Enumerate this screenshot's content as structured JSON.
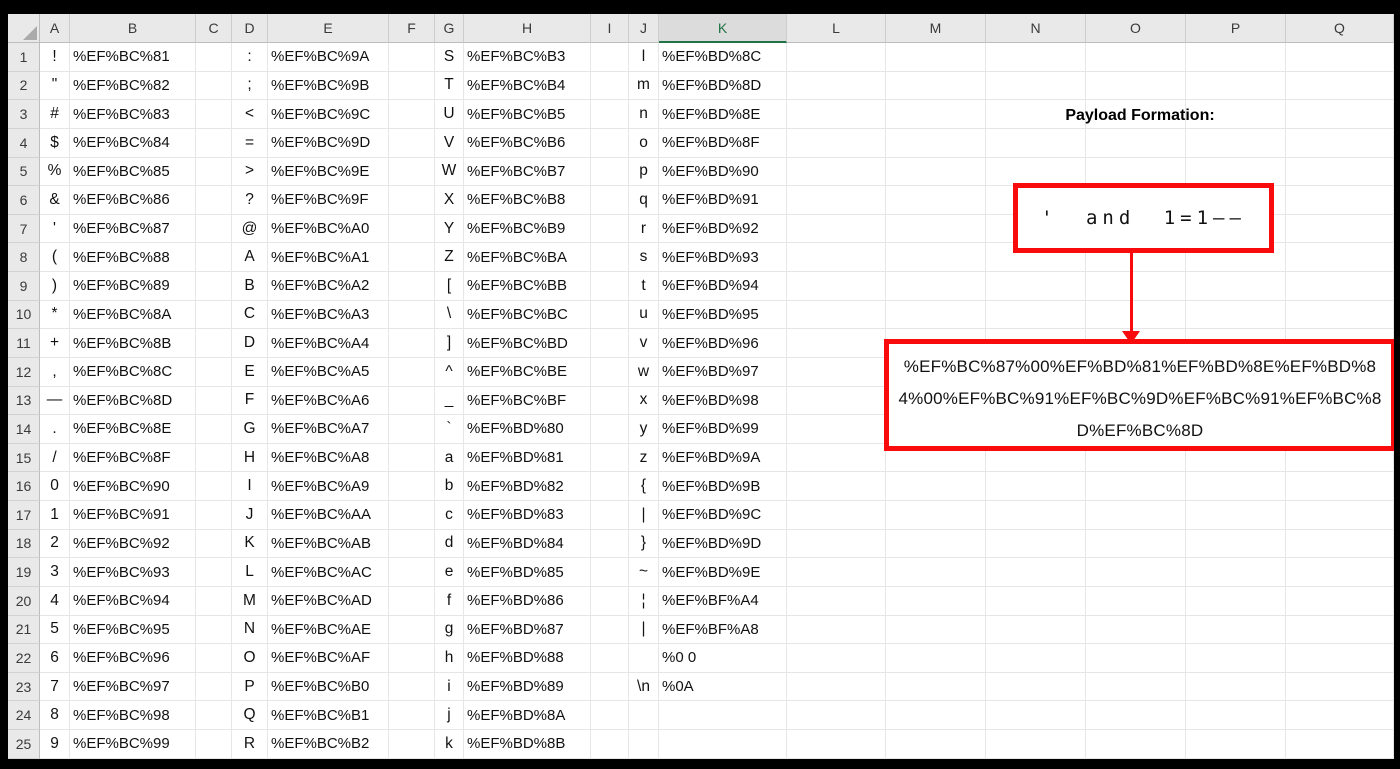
{
  "colors": {
    "accent_green": "#217346",
    "annotation_red": "#F90A0D",
    "header_bg": "#E9E9E9",
    "header_selected_bg": "#DCDCDC",
    "grid_line": "#E6E6E6",
    "cell_text": "#111111"
  },
  "grid": {
    "column_headers": [
      "A",
      "B",
      "C",
      "D",
      "E",
      "F",
      "G",
      "H",
      "I",
      "J",
      "K",
      "L",
      "M",
      "N",
      "O",
      "P",
      "Q"
    ],
    "selected_column": "K",
    "rows": [
      {
        "n": 1,
        "A": "!",
        "B": "%EF%BC%81",
        "D": ":",
        "E": "%EF%BC%9A",
        "G": "S",
        "H": "%EF%BC%B3",
        "J": "l",
        "K": "%EF%BD%8C"
      },
      {
        "n": 2,
        "A": "\"",
        "B": "%EF%BC%82",
        "D": ";",
        "E": "%EF%BC%9B",
        "G": "T",
        "H": "%EF%BC%B4",
        "J": "m",
        "K": "%EF%BD%8D"
      },
      {
        "n": 3,
        "A": "#",
        "B": "%EF%BC%83",
        "D": "<",
        "E": "%EF%BC%9C",
        "G": "U",
        "H": "%EF%BC%B5",
        "J": "n",
        "K": "%EF%BD%8E"
      },
      {
        "n": 4,
        "A": "$",
        "B": "%EF%BC%84",
        "D": "=",
        "E": "%EF%BC%9D",
        "G": "V",
        "H": "%EF%BC%B6",
        "J": "o",
        "K": "%EF%BD%8F"
      },
      {
        "n": 5,
        "A": "%",
        "B": "%EF%BC%85",
        "D": ">",
        "E": "%EF%BC%9E",
        "G": "W",
        "H": "%EF%BC%B7",
        "J": "p",
        "K": "%EF%BD%90"
      },
      {
        "n": 6,
        "A": "&",
        "B": "%EF%BC%86",
        "D": "?",
        "E": "%EF%BC%9F",
        "G": "X",
        "H": "%EF%BC%B8",
        "J": "q",
        "K": "%EF%BD%91"
      },
      {
        "n": 7,
        "A": "'",
        "B": "%EF%BC%87",
        "D": "@",
        "E": "%EF%BC%A0",
        "G": "Y",
        "H": "%EF%BC%B9",
        "J": "r",
        "K": "%EF%BD%92"
      },
      {
        "n": 8,
        "A": "(",
        "B": "%EF%BC%88",
        "D": "A",
        "E": "%EF%BC%A1",
        "G": "Z",
        "H": "%EF%BC%BA",
        "J": "s",
        "K": "%EF%BD%93"
      },
      {
        "n": 9,
        "A": ")",
        "B": "%EF%BC%89",
        "D": "B",
        "E": "%EF%BC%A2",
        "G": "[",
        "H": "%EF%BC%BB",
        "J": "t",
        "K": "%EF%BD%94"
      },
      {
        "n": 10,
        "A": "*",
        "B": "%EF%BC%8A",
        "D": "C",
        "E": "%EF%BC%A3",
        "G": "\\",
        "H": "%EF%BC%BC",
        "J": "u",
        "K": "%EF%BD%95"
      },
      {
        "n": 11,
        "A": "+",
        "B": "%EF%BC%8B",
        "D": "D",
        "E": "%EF%BC%A4",
        "G": "]",
        "H": "%EF%BC%BD",
        "J": "v",
        "K": "%EF%BD%96"
      },
      {
        "n": 12,
        "A": ",",
        "B": "%EF%BC%8C",
        "D": "E",
        "E": "%EF%BC%A5",
        "G": "^",
        "H": "%EF%BC%BE",
        "J": "w",
        "K": "%EF%BD%97"
      },
      {
        "n": 13,
        "A": "—",
        "B": "%EF%BC%8D",
        "D": "F",
        "E": "%EF%BC%A6",
        "G": "_",
        "H": "%EF%BC%BF",
        "J": "x",
        "K": "%EF%BD%98"
      },
      {
        "n": 14,
        "A": ".",
        "B": "%EF%BC%8E",
        "D": "G",
        "E": "%EF%BC%A7",
        "G": "`",
        "H": "%EF%BD%80",
        "J": "y",
        "K": "%EF%BD%99"
      },
      {
        "n": 15,
        "A": "/",
        "B": "%EF%BC%8F",
        "D": "H",
        "E": "%EF%BC%A8",
        "G": "a",
        "H": "%EF%BD%81",
        "J": "z",
        "K": "%EF%BD%9A"
      },
      {
        "n": 16,
        "A": "0",
        "B": "%EF%BC%90",
        "D": "I",
        "E": "%EF%BC%A9",
        "G": "b",
        "H": "%EF%BD%82",
        "J": "{",
        "K": "%EF%BD%9B"
      },
      {
        "n": 17,
        "A": "1",
        "B": "%EF%BC%91",
        "D": "J",
        "E": "%EF%BC%AA",
        "G": "c",
        "H": "%EF%BD%83",
        "J": "|",
        "K": "%EF%BD%9C"
      },
      {
        "n": 18,
        "A": "2",
        "B": "%EF%BC%92",
        "D": "K",
        "E": "%EF%BC%AB",
        "G": "d",
        "H": "%EF%BD%84",
        "J": "}",
        "K": "%EF%BD%9D"
      },
      {
        "n": 19,
        "A": "3",
        "B": "%EF%BC%93",
        "D": "L",
        "E": "%EF%BC%AC",
        "G": "e",
        "H": "%EF%BD%85",
        "J": "~",
        "K": "%EF%BD%9E"
      },
      {
        "n": 20,
        "A": "4",
        "B": "%EF%BC%94",
        "D": "M",
        "E": "%EF%BC%AD",
        "G": "f",
        "H": "%EF%BD%86",
        "J": "¦",
        "K": "%EF%BF%A4"
      },
      {
        "n": 21,
        "A": "5",
        "B": "%EF%BC%95",
        "D": "N",
        "E": "%EF%BC%AE",
        "G": "g",
        "H": "%EF%BD%87",
        "J": "|",
        "K": "%EF%BF%A8"
      },
      {
        "n": 22,
        "A": "6",
        "B": "%EF%BC%96",
        "D": "O",
        "E": "%EF%BC%AF",
        "G": "h",
        "H": "%EF%BD%88",
        "K": "%0 0"
      },
      {
        "n": 23,
        "A": "7",
        "B": "%EF%BC%97",
        "D": "P",
        "E": "%EF%BC%B0",
        "G": "i",
        "H": "%EF%BD%89",
        "J": "\\n",
        "K": "%0A"
      },
      {
        "n": 24,
        "A": "8",
        "B": "%EF%BC%98",
        "D": "Q",
        "E": "%EF%BC%B1",
        "G": "j",
        "H": "%EF%BD%8A"
      },
      {
        "n": 25,
        "A": "9",
        "B": "%EF%BC%99",
        "D": "R",
        "E": "%EF%BC%B2",
        "G": "k",
        "H": "%EF%BD%8B"
      }
    ]
  },
  "annotation": {
    "title": "Payload Formation:",
    "payload_input": "' and 1=1——",
    "payload_encoded": "%EF%BC%87%00%EF%BD%81%EF%BD%8E%EF%BD%84%00%EF%BC%91%EF%BC%9D%EF%BC%91%EF%BC%8D%EF%BC%8D",
    "arrow_icon": "down-arrow"
  }
}
